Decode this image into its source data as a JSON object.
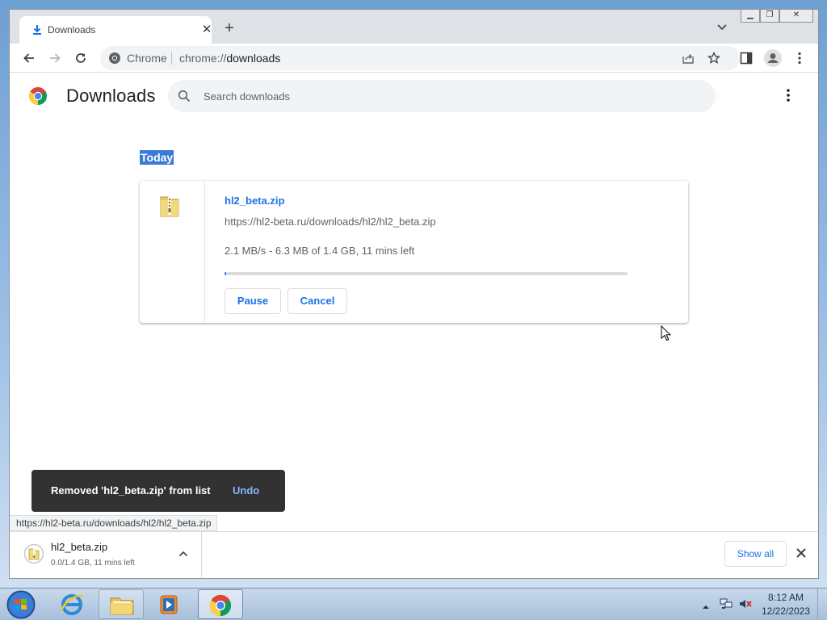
{
  "colors": {
    "accent": "#1a73e8",
    "selection": "#3a7bd5",
    "toast_bg": "#323232",
    "toast_action": "#8ab4f8"
  },
  "browser": {
    "tab": {
      "title": "Downloads",
      "icon": "download-icon"
    },
    "omnibox": {
      "site_label": "Chrome",
      "url_scheme": "chrome://",
      "url_host": "downloads"
    }
  },
  "downloads_page": {
    "title": "Downloads",
    "search_placeholder": "Search downloads",
    "date_group": "Today",
    "items": [
      {
        "file_name": "hl2_beta.zip",
        "url": "https://hl2-beta.ru/downloads/hl2/hl2_beta.zip",
        "status": "2.1 MB/s - 6.3 MB of 1.4 GB, 11 mins left",
        "progress_fraction": 0.0045,
        "pause_label": "Pause",
        "cancel_label": "Cancel",
        "icon": "zip-folder-icon"
      }
    ]
  },
  "toast": {
    "message": "Removed 'hl2_beta.zip' from list",
    "action": "Undo"
  },
  "status_bubble": "https://hl2-beta.ru/downloads/hl2/hl2_beta.zip",
  "shelf": {
    "item": {
      "name": "hl2_beta.zip",
      "status": "0.0/1.4 GB, 11 mins left"
    },
    "show_all_label": "Show all"
  },
  "taskbar": {
    "apps": [
      "internet-explorer-icon",
      "file-explorer-icon",
      "media-player-icon",
      "chrome-icon"
    ],
    "clock": {
      "time": "8:12 AM",
      "date": "12/22/2023"
    }
  }
}
